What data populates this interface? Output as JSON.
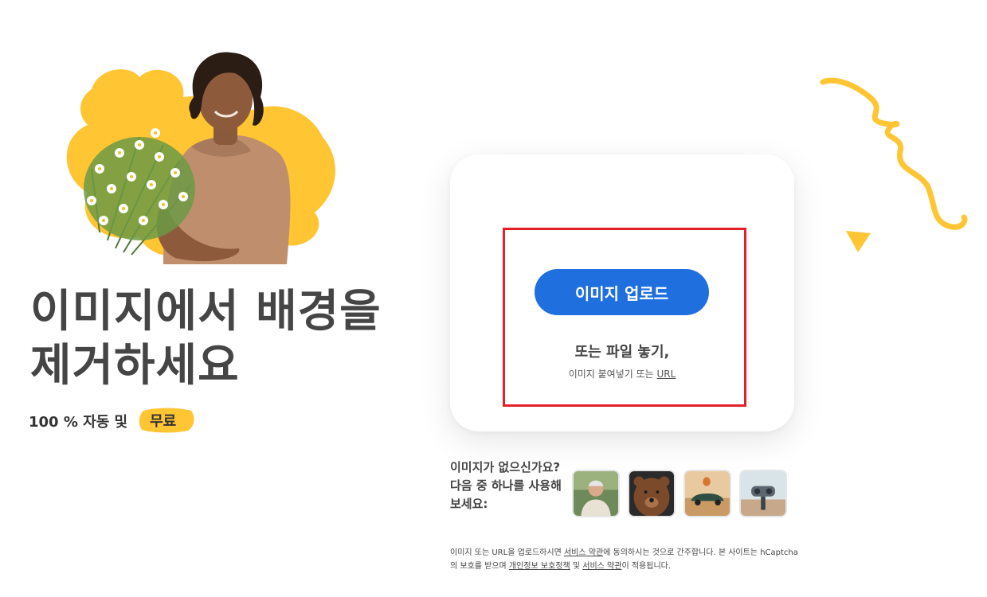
{
  "hero": {
    "headline": "이미지에서 배경을\n제거하세요",
    "tagline_prefix": "100 % 자동 및",
    "tagline_badge": "무료",
    "image_icon": "woman-holding-flowers-photo"
  },
  "upload": {
    "button_label": "이미지 업로드",
    "drop_title": "또는 파일 놓기,",
    "drop_sub_prefix": "이미지 붙여넣기 또는 ",
    "drop_sub_link": "URL"
  },
  "samples": {
    "prompt": "이미지가 없으신가요?\n다음 중 하나를 사용해 보세요:",
    "items": [
      {
        "icon": "man-portrait-thumbnail"
      },
      {
        "icon": "bear-thumbnail"
      },
      {
        "icon": "vintage-car-thumbnail"
      },
      {
        "icon": "binocular-viewer-thumbnail"
      }
    ]
  },
  "legal": {
    "p1": "이미지 또는 URL을 업로드하시면 ",
    "link_terms": "서비스 약관",
    "p2": "에 동의하시는 것으로 간주합니다. 본 사이트는 hCaptcha의 보호를 받으며 ",
    "link_privacy": "개인정보 보호정책",
    "p3": " 및 ",
    "link_terms2": "서비스 약관",
    "p4": "이 적용됩니다."
  },
  "colors": {
    "accent_blue": "#1f6fdf",
    "accent_yellow": "#ffc533",
    "highlight_red": "#e3202a",
    "text": "#454545"
  }
}
